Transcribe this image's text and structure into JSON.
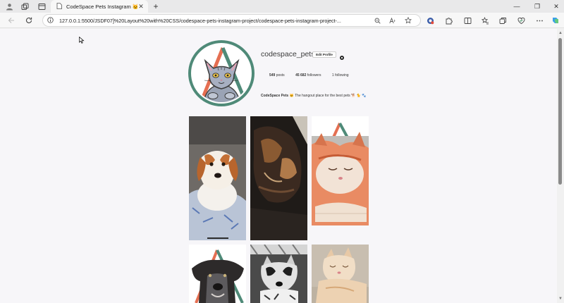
{
  "browser": {
    "tab_title": "CodeSpace Pets Instagram 🐱",
    "tab_close": "✕",
    "new_tab": "+",
    "url": "127.0.0.1:5500/JSDF07]%20Layout%20with%20CSS/codespace-pets-instagram-project/codespace-pets-instagram-project-...",
    "window_controls": [
      "—",
      "❐",
      "✕"
    ],
    "icons": [
      "profile-icon",
      "workspaces-icon",
      "tab-actions-icon",
      "back-icon",
      "refresh-icon",
      "info-icon",
      "zoom-icon",
      "read-aloud-icon",
      "favorite-star-icon",
      "shield-icon",
      "extensions-icon",
      "split-screen-icon",
      "favorites-icon",
      "collections-icon",
      "browser-essentials-icon",
      "more-icon",
      "copilot-icon"
    ]
  },
  "profile": {
    "username": "codespace_pets",
    "edit_label": "Edit Profile",
    "posts_count": "549",
    "posts_label": "posts",
    "followers_count": "45 682",
    "followers_label": "followers",
    "following_count": "1",
    "following_label": "following",
    "bio_name": "CodeSpace Pets 🐱",
    "bio_text": "The hangout place for the best pets 🐕 🐈 🐾"
  },
  "photos": [
    {
      "subject": "puppy"
    },
    {
      "subject": "tortoiseshell-cat"
    },
    {
      "subject": "sleeping-orange-cat"
    },
    {
      "subject": "dark-dog"
    },
    {
      "subject": "black-white-dog"
    },
    {
      "subject": "cream-cat"
    }
  ],
  "colors": {
    "logo_teal": "#4f8a78",
    "logo_coral": "#e56f52",
    "page_bg": "#f7f6f9"
  }
}
